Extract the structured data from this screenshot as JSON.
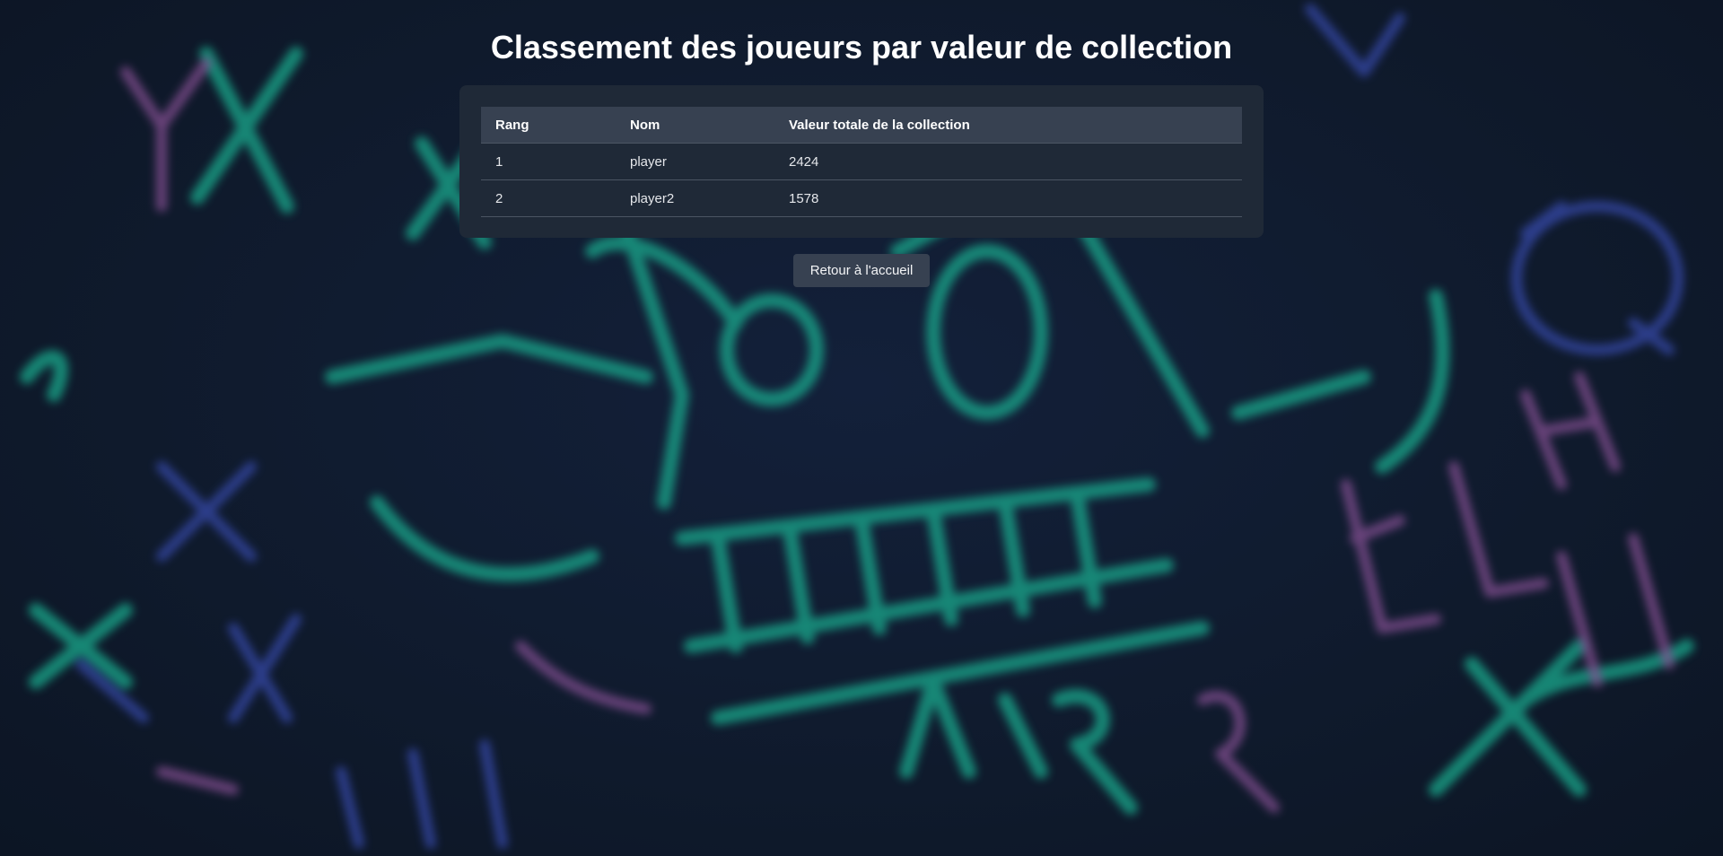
{
  "page": {
    "title": "Classement des joueurs par valeur de collection"
  },
  "leaderboard": {
    "columns": [
      "Rang",
      "Nom",
      "Valeur totale de la collection"
    ],
    "rows": [
      {
        "rank": "1",
        "name": "player",
        "value": "2424"
      },
      {
        "rank": "2",
        "name": "player2",
        "value": "1578"
      }
    ]
  },
  "actions": {
    "back_label": "Retour à l'accueil"
  },
  "colors": {
    "background": "#101a2b",
    "card": "#1f2937",
    "header_row": "#374151",
    "button": "#374151",
    "graffiti_teal": "#1aa88c",
    "graffiti_purple": "#9b5aa6",
    "graffiti_blue": "#3b4fb8"
  }
}
